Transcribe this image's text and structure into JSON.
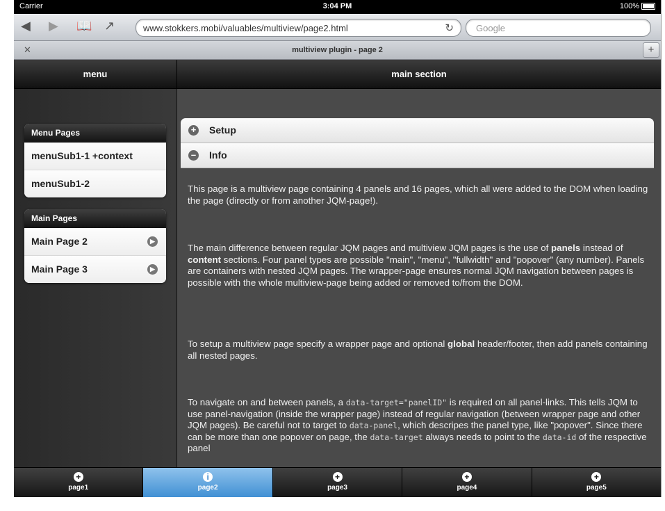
{
  "status": {
    "carrier": "Carrier",
    "time": "3:04 PM",
    "battery": "100%"
  },
  "browser": {
    "url": "www.stokkers.mobi/valuables/multiview/page2.html",
    "search_placeholder": "Google",
    "tab_title": "multiview plugin - page 2"
  },
  "headers": {
    "menu": "menu",
    "main": "main section"
  },
  "sidebar": {
    "menu_pages": {
      "title": "Menu Pages",
      "items": [
        "menuSub1-1 +context",
        "menuSub1-2"
      ]
    },
    "main_pages": {
      "title": "Main Pages",
      "items": [
        "Main Page 2",
        "Main Page 3"
      ]
    }
  },
  "collapsibles": [
    {
      "label": "Setup",
      "icon": "plus-icon",
      "expanded": false
    },
    {
      "label": "Info",
      "icon": "minus-icon",
      "expanded": true
    }
  ],
  "paragraphs": {
    "p1": "This page is a multiview page containing 4 panels and 16 pages, which all were added to the DOM when loading the page (directly or from another JQM-page!).",
    "p2_a": "The main difference between regular JQM pages and multiview JQM pages is the use of ",
    "p2_b": "panels",
    "p2_c": " instead of ",
    "p2_d": "content",
    "p2_e": " sections. Four panel types are possible \"main\", \"menu\", \"fullwidth\" and \"popover\" (any number). Panels are containers with nested JQM pages. The wrapper-page ensures normal JQM navigation between pages is possible with the whole multiview-page being added or removed to/from the DOM.",
    "p3_a": "To setup a multiview page specify a wrapper page and optional ",
    "p3_b": "global",
    "p3_c": " header/footer, then add panels containing all nested pages.",
    "p4_a": "To navigate on and between panels, a ",
    "p4_code1": "data-target=\"panelID\"",
    "p4_b": " is required on all panel-links. This tells JQM to use panel-navigation (inside the wrapper page) instead of regular navigation (between wrapper page and other JQM pages). Be careful not to target to ",
    "p4_code2": "data-panel",
    "p4_c": ", which descripes the panel type, like \"popover\". Since there can be more than one popover on page, the ",
    "p4_code3": "data-target",
    "p4_d": " always needs to point to the ",
    "p4_code4": "data-id",
    "p4_e": " of the respective panel"
  },
  "footer_tabs": [
    {
      "label": "page1",
      "icon": "plus-icon",
      "active": false
    },
    {
      "label": "page2",
      "icon": "info-icon",
      "active": true
    },
    {
      "label": "page3",
      "icon": "plus-icon",
      "active": false
    },
    {
      "label": "page4",
      "icon": "plus-icon",
      "active": false
    },
    {
      "label": "page5",
      "icon": "plus-icon",
      "active": false
    }
  ],
  "colors": {
    "active_tab": "#3f8fd3",
    "bar_dark": "#111111",
    "content_bg": "#4a4a4a"
  }
}
